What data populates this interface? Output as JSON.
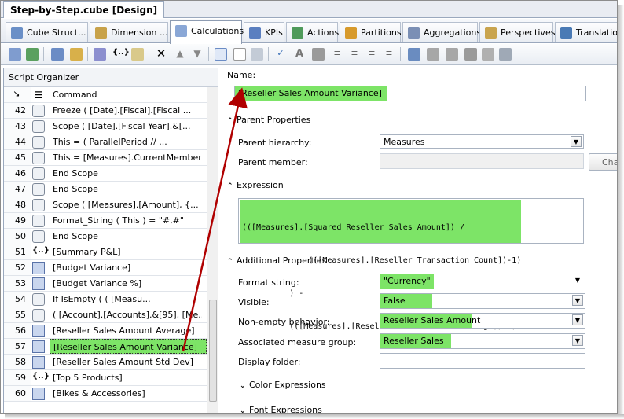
{
  "document_tab": "Step-by-Step.cube [Design]",
  "tabs": [
    {
      "label": "Cube Struct...",
      "icon": "cube-structure-icon",
      "active": false
    },
    {
      "label": "Dimension ...",
      "icon": "dimension-usage-icon",
      "active": false
    },
    {
      "label": "Calculations",
      "icon": "calculations-icon",
      "active": true
    },
    {
      "label": "KPIs",
      "icon": "kpis-icon",
      "active": false
    },
    {
      "label": "Actions",
      "icon": "actions-icon",
      "active": false
    },
    {
      "label": "Partitions",
      "icon": "partitions-icon",
      "active": false
    },
    {
      "label": "Aggregations",
      "icon": "aggregations-icon",
      "active": false
    },
    {
      "label": "Perspectives",
      "icon": "perspectives-icon",
      "active": false
    },
    {
      "label": "Translation",
      "icon": "translations-icon",
      "active": false
    }
  ],
  "toolbar_icons": [
    "process-icon",
    "reconnect-icon",
    "new-calculated-member-icon",
    "new-named-set-icon",
    "new-calculation-icon",
    "new-script-command-icon",
    "delete-icon",
    "move-up-icon",
    "move-down-icon",
    "form-view-icon",
    "script-view-icon",
    "calculation-tools-icon",
    "check-syntax-icon",
    "font-icon",
    "background-color-icon",
    "align-left-icon",
    "align-center-icon",
    "align-right-icon",
    "justify-icon",
    "user-icon",
    "properties-icon",
    "copy-icon",
    "filter-icon",
    "edit-icon",
    "template-icon"
  ],
  "script_organizer": {
    "title": "Script Organizer",
    "header": {
      "col": "Command"
    },
    "rows": [
      {
        "num": "42",
        "type": "script",
        "text": "Freeze   (      [Date].[Fiscal].[Fiscal ..."
      },
      {
        "num": "43",
        "type": "script",
        "text": "Scope   (     [Date].[Fiscal Year].&[..."
      },
      {
        "num": "44",
        "type": "script",
        "text": "This =    (      ParallelPeriod       // ..."
      },
      {
        "num": "45",
        "type": "script",
        "text": "This = [Measures].CurrentMember ..."
      },
      {
        "num": "46",
        "type": "script",
        "text": "End Scope"
      },
      {
        "num": "47",
        "type": "script",
        "text": "End Scope"
      },
      {
        "num": "48",
        "type": "script",
        "text": "Scope (   [Measures].[Amount],   {..."
      },
      {
        "num": "49",
        "type": "script",
        "text": "Format_String ( This ) = \"#,#\""
      },
      {
        "num": "50",
        "type": "script",
        "text": "End Scope"
      },
      {
        "num": "51",
        "type": "set",
        "text": "[Summary P&L]"
      },
      {
        "num": "52",
        "type": "calc",
        "text": "[Budget Variance]"
      },
      {
        "num": "53",
        "type": "calc",
        "text": "[Budget Variance %]"
      },
      {
        "num": "54",
        "type": "script",
        "text": "If    IsEmpty    (       (          [Measu..."
      },
      {
        "num": "55",
        "type": "script",
        "text": "( [Account].[Accounts].&[95],  [Me..."
      },
      {
        "num": "56",
        "type": "calc",
        "text": "[Reseller Sales Amount Average]"
      },
      {
        "num": "57",
        "type": "calc",
        "text": "[Reseller Sales Amount Variance]",
        "selected": true
      },
      {
        "num": "58",
        "type": "calc",
        "text": "[Reseller Sales Amount Std Dev]"
      },
      {
        "num": "59",
        "type": "set",
        "text": "[Top 5 Products]"
      },
      {
        "num": "60",
        "type": "calc",
        "text": "[Bikes & Accessories]"
      }
    ]
  },
  "form": {
    "name_label": "Name:",
    "name_value": "[Reseller Sales Amount Variance]",
    "parent_properties": "Parent Properties",
    "parent_hierarchy_label": "Parent hierarchy:",
    "parent_hierarchy_value": "Measures",
    "parent_member_label": "Parent member:",
    "parent_member_value": "",
    "change_button": "Cha",
    "expression_label": "Expression",
    "expression_lines": [
      "(([Measures].[Squared Reseller Sales Amount]) /",
      "              (([Measures].[Reseller Transaction Count])-1)",
      "          ) -",
      "          (([Measures].[Reseller Sales Amount Average])^2)"
    ],
    "additional_properties": "Additional Properties",
    "format_string_label": "Format string:",
    "format_string_value": "\"Currency\"",
    "visible_label": "Visible:",
    "visible_value": "False",
    "non_empty_label": "Non-empty behavior:",
    "non_empty_value": "Reseller Sales Amount",
    "measure_group_label": "Associated measure group:",
    "measure_group_value": "Reseller Sales",
    "display_folder_label": "Display folder:",
    "display_folder_value": "",
    "color_expressions": "Color Expressions",
    "font_expressions": "Font Expressions"
  },
  "colors": {
    "highlight": "#7de467",
    "arrow": "#b00000",
    "tab_border": "#9aa8bd"
  }
}
